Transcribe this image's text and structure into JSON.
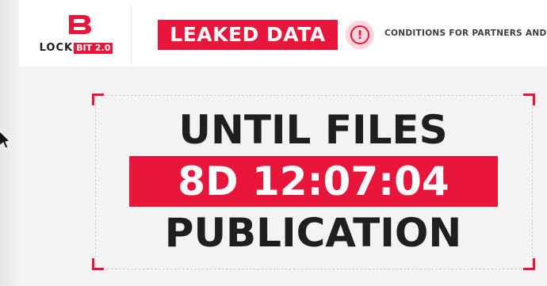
{
  "header": {
    "logo": {
      "word": "LOCK",
      "badge": "BIT 2.0"
    },
    "leaked_data_label": "LEAKED DATA",
    "alert_icon": "exclamation-circle-icon",
    "conditions_link": "CONDITIONS FOR PARTNERS AND C"
  },
  "countdown": {
    "line1": "UNTIL FILES",
    "timer": "8D 12:07:04",
    "line2": "PUBLICATION"
  },
  "colors": {
    "accent": "#e8163a",
    "text_dark": "#1f1f1f",
    "alert_bg": "#fbd5dc"
  }
}
